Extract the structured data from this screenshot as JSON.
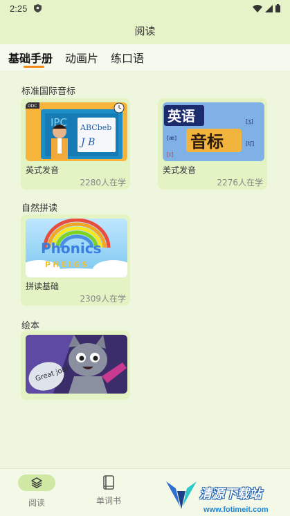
{
  "status_bar": {
    "time": "2:25"
  },
  "app_bar": {
    "title": "阅读"
  },
  "tabs": [
    {
      "label": "基础手册",
      "active": true
    },
    {
      "label": "动画片",
      "active": false
    },
    {
      "label": "练口语",
      "active": false
    }
  ],
  "sections": [
    {
      "title": "标准国际音标",
      "cards": [
        {
          "name": "英式发音",
          "learners": "2280人在学",
          "thumb_text": "ABCbeb"
        },
        {
          "name": "美式发音",
          "learners": "2276人在学",
          "thumb_line1": "英语",
          "thumb_line2": "音标"
        }
      ]
    },
    {
      "title": "自然拼读",
      "cards": [
        {
          "name": "拼读基础",
          "learners": "2309人在学",
          "thumb_line1": "Phonics",
          "thumb_line2": "PHEIGS"
        }
      ]
    },
    {
      "title": "绘本",
      "cards": [
        {
          "name": "",
          "learners": "",
          "thumb_text": "Great job!"
        }
      ]
    }
  ],
  "bottom_nav": [
    {
      "label": "阅读",
      "icon": "layers-icon",
      "active": true
    },
    {
      "label": "单词书",
      "icon": "book-icon",
      "active": false
    }
  ],
  "watermark": {
    "text": "清源下载站",
    "url": "www.fotimeit.com"
  },
  "colors": {
    "accent": "#f28a18",
    "header": "#e6f3c8",
    "card": "#e3f3c4",
    "background": "#eef6de"
  }
}
